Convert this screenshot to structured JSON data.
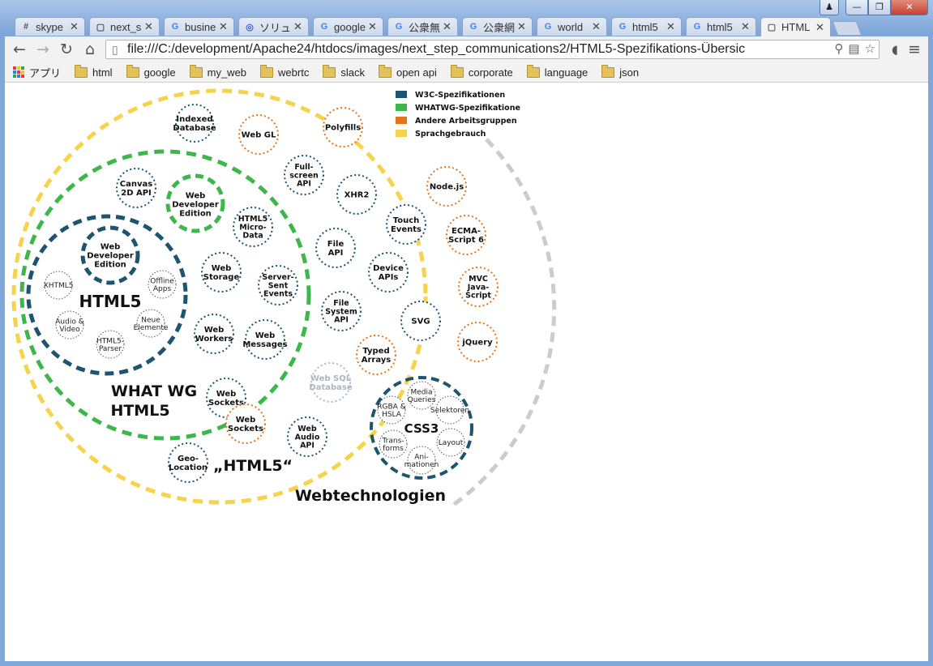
{
  "window": {
    "user_icon": "user-icon",
    "min": "—",
    "max": "❐",
    "close": "✕"
  },
  "tabs": [
    {
      "title": "skype",
      "icon": "#",
      "icon_color": "#555555"
    },
    {
      "title": "next_s",
      "icon": "▢",
      "icon_color": "#555555"
    },
    {
      "title": "busine",
      "icon": "G",
      "icon_color": "#4285f4"
    },
    {
      "title": "ソリュ",
      "icon": "◎",
      "icon_color": "#3b5bdb"
    },
    {
      "title": "google",
      "icon": "G",
      "icon_color": "#4285f4"
    },
    {
      "title": "公衆無",
      "icon": "G",
      "icon_color": "#4285f4"
    },
    {
      "title": "公衆網",
      "icon": "G",
      "icon_color": "#4285f4"
    },
    {
      "title": "world",
      "icon": "G",
      "icon_color": "#4285f4"
    },
    {
      "title": "html5",
      "icon": "G",
      "icon_color": "#4285f4"
    },
    {
      "title": "html5",
      "icon": "G",
      "icon_color": "#4285f4"
    },
    {
      "title": "HTML",
      "icon": "▢",
      "icon_color": "#555555"
    }
  ],
  "toolbar": {
    "back": "←",
    "forward": "→",
    "reload": "↻",
    "home": "⌂",
    "menu": "≡",
    "extension": "◖"
  },
  "address_bar": {
    "url": "file:///C:/development/Apache24/htdocs/images/next_step_communications2/HTML5-Spezifikations-Übersic",
    "icons": [
      "search-icon",
      "reader-icon",
      "star-icon"
    ]
  },
  "bookmarks": {
    "apps_label": "アプリ",
    "items": [
      "html",
      "google",
      "my_web",
      "webrtc",
      "slack",
      "open api",
      "corporate",
      "language",
      "json"
    ]
  },
  "colors": {
    "w3c": "#1d5470",
    "whatwg": "#3db74b",
    "other": "#e8741a",
    "usage": "#f6d34a",
    "web": "#cccccc"
  },
  "legend": [
    {
      "label": "W3C-Spezifikationen",
      "color": "#1d5470"
    },
    {
      "label": "WHATWG-Spezifikatione",
      "color": "#3db74b"
    },
    {
      "label": "Andere Arbeitsgruppen",
      "color": "#e8741a"
    },
    {
      "label": "Sprachgebrauch",
      "color": "#f6d34a"
    }
  ],
  "big_labels": {
    "html5": "HTML5",
    "whatwg_1": "WHAT WG",
    "whatwg_2": "HTML5",
    "html5_quoted": "„HTML5“",
    "css3": "CSS3",
    "webtech": "Webtechnologien"
  },
  "nodes": [
    {
      "kind": "w3c",
      "lines": [
        "Indexed",
        "Database"
      ]
    },
    {
      "kind": "other",
      "lines": [
        "Web GL"
      ]
    },
    {
      "kind": "other",
      "lines": [
        "Polyfills"
      ]
    },
    {
      "kind": "w3c",
      "lines": [
        "Canvas",
        "2D API"
      ]
    },
    {
      "kind": "w3c",
      "lines": [
        "Full-",
        "screen",
        "API"
      ]
    },
    {
      "kind": "w3c",
      "lines": [
        "XHR2"
      ]
    },
    {
      "kind": "other",
      "lines": [
        "Node.js"
      ]
    },
    {
      "kind": "w3c",
      "lines": [
        "HTML5",
        "Micro-",
        "Data"
      ]
    },
    {
      "kind": "w3c",
      "lines": [
        "Touch",
        "Events"
      ]
    },
    {
      "kind": "other",
      "lines": [
        "ECMA-",
        "Script 6"
      ]
    },
    {
      "kind": "w3c",
      "lines": [
        "File",
        "API"
      ]
    },
    {
      "kind": "w3c",
      "lines": [
        "Web",
        "Storage"
      ]
    },
    {
      "kind": "w3c",
      "lines": [
        "Server-",
        "Sent",
        "Events"
      ]
    },
    {
      "kind": "w3c",
      "lines": [
        "Device",
        "APIs"
      ]
    },
    {
      "kind": "other",
      "lines": [
        "MVC",
        "Java-",
        "Script"
      ]
    },
    {
      "kind": "w3c",
      "lines": [
        "File",
        "System",
        "API"
      ]
    },
    {
      "kind": "w3c",
      "lines": [
        "SVG"
      ]
    },
    {
      "kind": "w3c",
      "lines": [
        "Web",
        "Workers"
      ]
    },
    {
      "kind": "w3c",
      "lines": [
        "Web",
        "Messages"
      ]
    },
    {
      "kind": "other",
      "lines": [
        "jQuery"
      ]
    },
    {
      "kind": "other",
      "lines": [
        "Typed",
        "Arrays"
      ]
    },
    {
      "kind": "faded",
      "lines": [
        "Web SQL",
        "Database"
      ]
    },
    {
      "kind": "w3c",
      "lines": [
        "Web",
        "Sockets"
      ]
    },
    {
      "kind": "other",
      "lines": [
        "Web",
        "Sockets"
      ]
    },
    {
      "kind": "w3c",
      "lines": [
        "Web",
        "Audio",
        "API"
      ]
    },
    {
      "kind": "w3c",
      "lines": [
        "Geo-",
        "Location"
      ]
    }
  ],
  "webdev_edition": [
    "Web",
    "Developer",
    "Edition"
  ],
  "html5_inner": [
    {
      "lines": [
        "XHTML5"
      ]
    },
    {
      "lines": [
        "Offline",
        "Apps"
      ]
    },
    {
      "lines": [
        "Audio &",
        "Video"
      ]
    },
    {
      "lines": [
        "Neue",
        "Elemente"
      ]
    },
    {
      "lines": [
        "HTML5-",
        "Parser"
      ]
    }
  ],
  "css3_inner": [
    {
      "lines": [
        "Media",
        "Queries"
      ]
    },
    {
      "lines": [
        "RGBA &",
        "HSLA"
      ]
    },
    {
      "lines": [
        "Selektoren"
      ]
    },
    {
      "lines": [
        "Trans-",
        "forms"
      ]
    },
    {
      "lines": [
        "Layout"
      ]
    },
    {
      "lines": [
        "Ani-",
        "mationen"
      ]
    }
  ]
}
